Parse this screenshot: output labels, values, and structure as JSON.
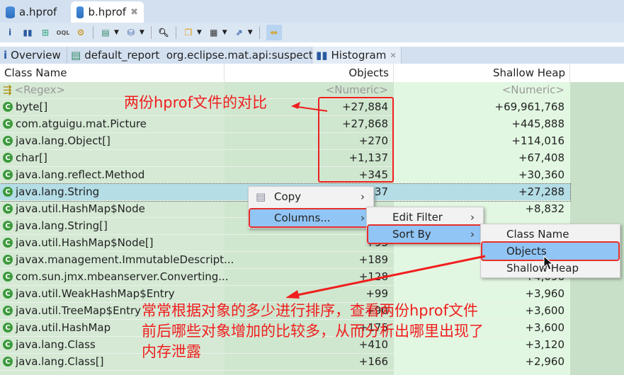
{
  "editor_tabs": [
    {
      "label": "a.hprof",
      "active": false
    },
    {
      "label": "b.hprof",
      "active": true
    }
  ],
  "view_tabs": [
    {
      "label": "Overview"
    },
    {
      "label": "default_report  org.eclipse.mat.api:suspects"
    },
    {
      "label": "Histogram",
      "active": true
    }
  ],
  "table": {
    "columns": [
      "Class Name",
      "Objects",
      "Shallow Heap"
    ],
    "filter_row": {
      "name": "<Regex>",
      "objects": "<Numeric>",
      "shallow": "<Numeric>"
    },
    "rows": [
      {
        "name": "byte[]",
        "objects": "+27,884",
        "shallow": "+69,961,768"
      },
      {
        "name": "com.atguigu.mat.Picture",
        "objects": "+27,868",
        "shallow": "+445,888"
      },
      {
        "name": "java.lang.Object[]",
        "objects": "+270",
        "shallow": "+114,016"
      },
      {
        "name": "char[]",
        "objects": "+1,137",
        "shallow": "+67,408"
      },
      {
        "name": "java.lang.reflect.Method",
        "objects": "+345",
        "shallow": "+30,360"
      },
      {
        "name": "java.lang.String",
        "objects": "137",
        "shallow": "+27,288",
        "selected": true
      },
      {
        "name": "java.util.HashMap$Node",
        "objects": "",
        "shallow": "+8,832"
      },
      {
        "name": "java.lang.String[]",
        "objects": "",
        "shallow": ""
      },
      {
        "name": "java.util.HashMap$Node[]",
        "objects": "+93",
        "shallow": ""
      },
      {
        "name": "javax.management.ImmutableDescript...",
        "objects": "+189",
        "shallow": ""
      },
      {
        "name": "com.sun.jmx.mbeanserver.Converting...",
        "objects": "+128",
        "shallow": "+4,096"
      },
      {
        "name": "java.util.WeakHashMap$Entry",
        "objects": "+99",
        "shallow": "+3,960"
      },
      {
        "name": "java.util.TreeMap$Entry",
        "objects": "+90",
        "shallow": "+3,600"
      },
      {
        "name": "java.util.HashMap",
        "objects": "+175",
        "shallow": "+3,600"
      },
      {
        "name": "java.lang.Class",
        "objects": "+410",
        "shallow": "+3,120"
      },
      {
        "name": "java.lang.Class[]",
        "objects": "+166",
        "shallow": "+2,960"
      }
    ]
  },
  "context_menu": {
    "items": [
      {
        "label": "Copy"
      },
      {
        "label": "Columns...",
        "highlighted": true
      }
    ]
  },
  "columns_submenu": {
    "items": [
      {
        "label": "Edit Filter"
      },
      {
        "label": "Sort By",
        "highlighted": true
      }
    ]
  },
  "sortby_submenu": {
    "items": [
      {
        "label": "Class Name"
      },
      {
        "label": "Objects",
        "highlighted": true
      },
      {
        "label": "Shallow Heap"
      }
    ]
  },
  "annotations": {
    "top": "两份hprof文件的对比",
    "bottom": [
      "常常根据对象的多少进行排序，查看两份hprof文件",
      "前后哪些对象增加的比较多，从而分析出哪里出现了",
      "内存泄露"
    ]
  },
  "colors": {
    "annotation": "#f01e1e",
    "menu_highlight": "#91c5f5",
    "selected_row": "#b4dde6"
  }
}
